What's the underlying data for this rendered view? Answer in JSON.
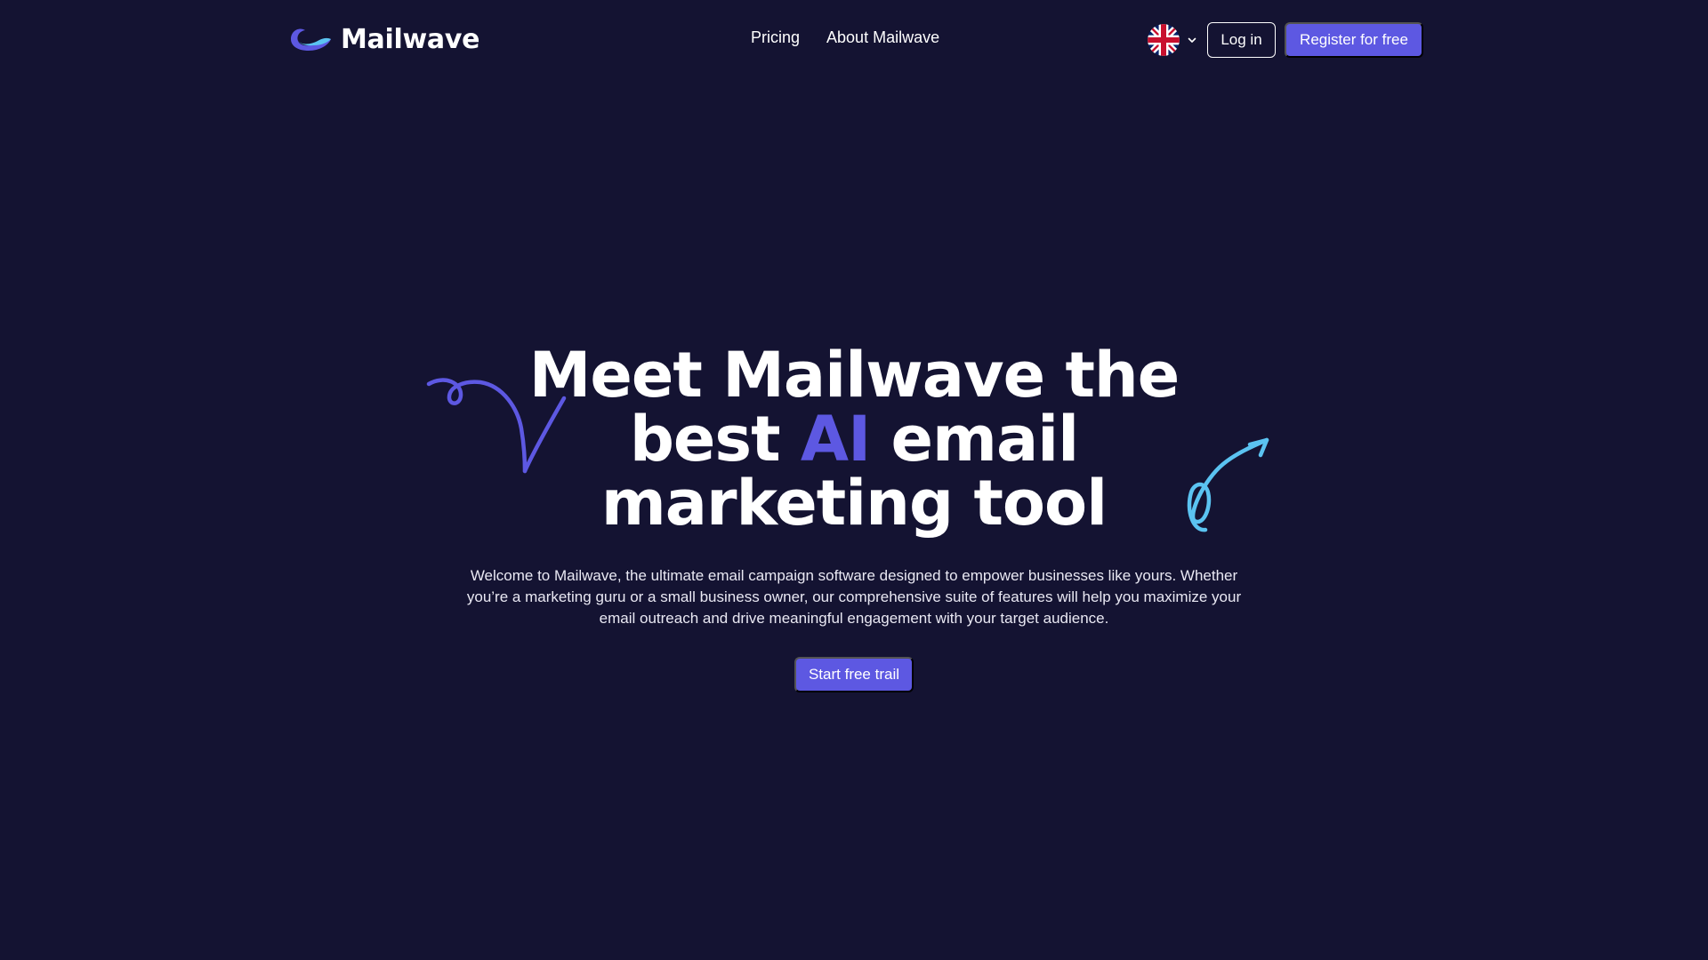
{
  "brand": {
    "name": "Mailwave",
    "logo_icon": "wave-logo-icon",
    "accent_color": "#5d58e2",
    "background_color": "#141332",
    "light_accent_color": "#5bc3f1"
  },
  "nav": {
    "links": [
      {
        "label": "Pricing"
      },
      {
        "label": "About Mailwave"
      }
    ]
  },
  "language": {
    "icon": "uk-flag-icon",
    "dropdown_icon": "chevron-down-icon"
  },
  "header_actions": {
    "login_label": "Log in",
    "register_label": "Register for free"
  },
  "hero": {
    "title_part1": "Meet Mailwave the best",
    "title_accent": "AI",
    "title_part2": "email marketing tool",
    "description": "Welcome to Mailwave, the ultimate email campaign software designed to empower businesses like yours. Whether you’re a marketing guru or a small business owner, our comprehensive suite of features will help you maximize your email outreach and drive meaningful engagement with your target audience.",
    "cta_label": "Start free trail",
    "decorations": [
      "purple-squiggle-arrow-icon",
      "blue-squiggle-arrow-icon"
    ]
  }
}
